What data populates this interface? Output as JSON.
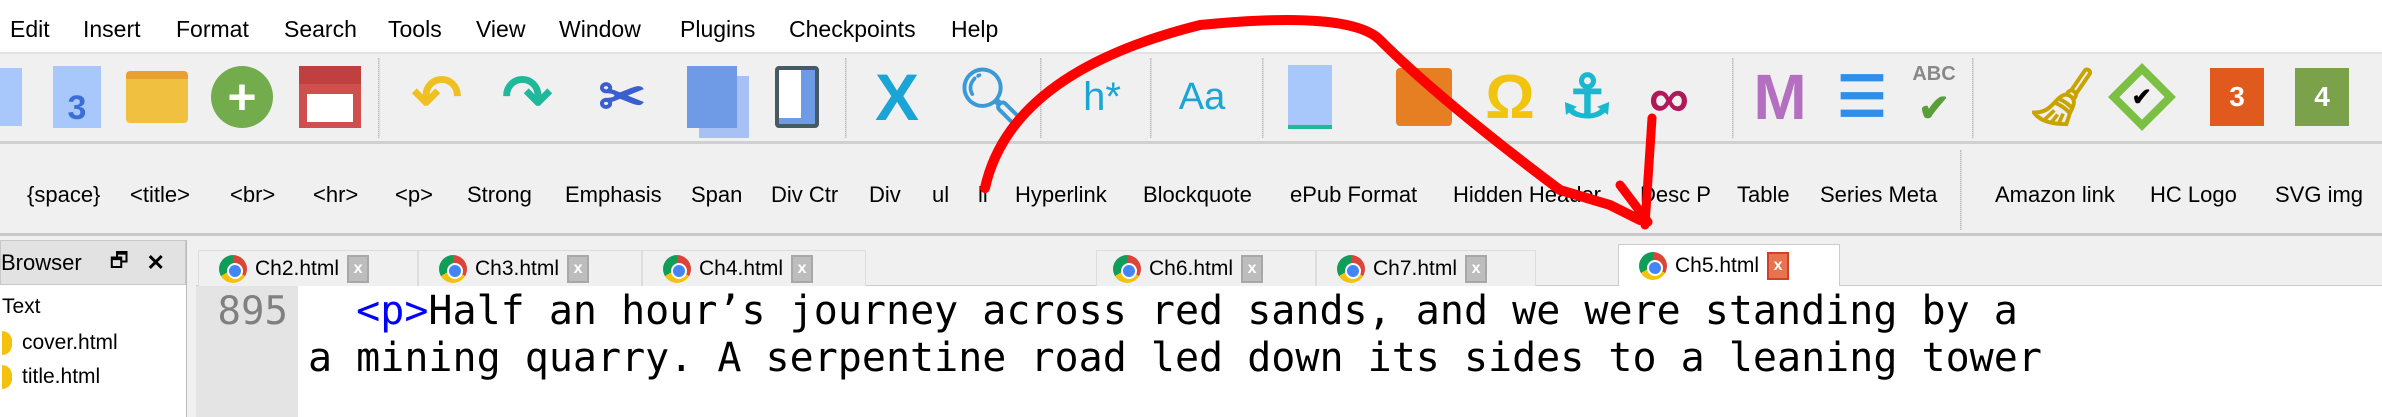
{
  "menu": [
    "Edit",
    "Insert",
    "Format",
    "Search",
    "Tools",
    "View",
    "Window",
    "Plugins",
    "Checkpoints",
    "Help"
  ],
  "toolbar_icons": [
    "new-file-icon",
    "epub3-icon",
    "open-folder-icon",
    "add-file-icon",
    "save-icon",
    "undo-icon",
    "redo-icon",
    "cut-icon",
    "copy-icon",
    "paste-icon",
    "delete-edit-icon",
    "find-icon",
    "heading-icon",
    "case-icon",
    "split-icon",
    "image-icon",
    "special-char-icon",
    "anchor-icon",
    "link-icon",
    "metadata-icon",
    "toc-icon",
    "spellcheck-icon",
    "clean-icon",
    "epubcheck-icon",
    "plugin-3-icon",
    "plugin-4-icon"
  ],
  "toolbar_text": {
    "heading": "h*",
    "case": "Aa",
    "abc": "ABC",
    "plugin3": "3",
    "plugin4": "4",
    "epub3": "3"
  },
  "clips": [
    "{space}",
    "<title>",
    "<br>",
    "<hr>",
    "<p>",
    "Strong",
    "Emphasis",
    "Span",
    "Div Ctr",
    "Div",
    "ul",
    "li",
    "Hyperlink",
    "Blockquote",
    "ePub Format",
    "Hidden Header",
    "Desc P",
    "Table",
    "Series Meta"
  ],
  "clips2": [
    "Amazon link",
    "HC Logo",
    "SVG img"
  ],
  "browser": {
    "title": "Browser",
    "items": [
      "Text",
      "cover.html",
      "title.html"
    ]
  },
  "tabs": [
    "Ch2.html",
    "Ch3.html",
    "Ch4.html",
    "Ch6.html",
    "Ch7.html",
    "Ch5.html"
  ],
  "active_tab": "Ch5.html",
  "editor": {
    "line_number": "895",
    "tag": "<p>",
    "line1": "Half an hour’s journey across red sands, and we were standing by a",
    "line2": "a mining quarry. A serpentine road led down its sides to a leaning tower"
  },
  "colors": {
    "annotation": "#ff0000",
    "tag": "#0000ff"
  }
}
